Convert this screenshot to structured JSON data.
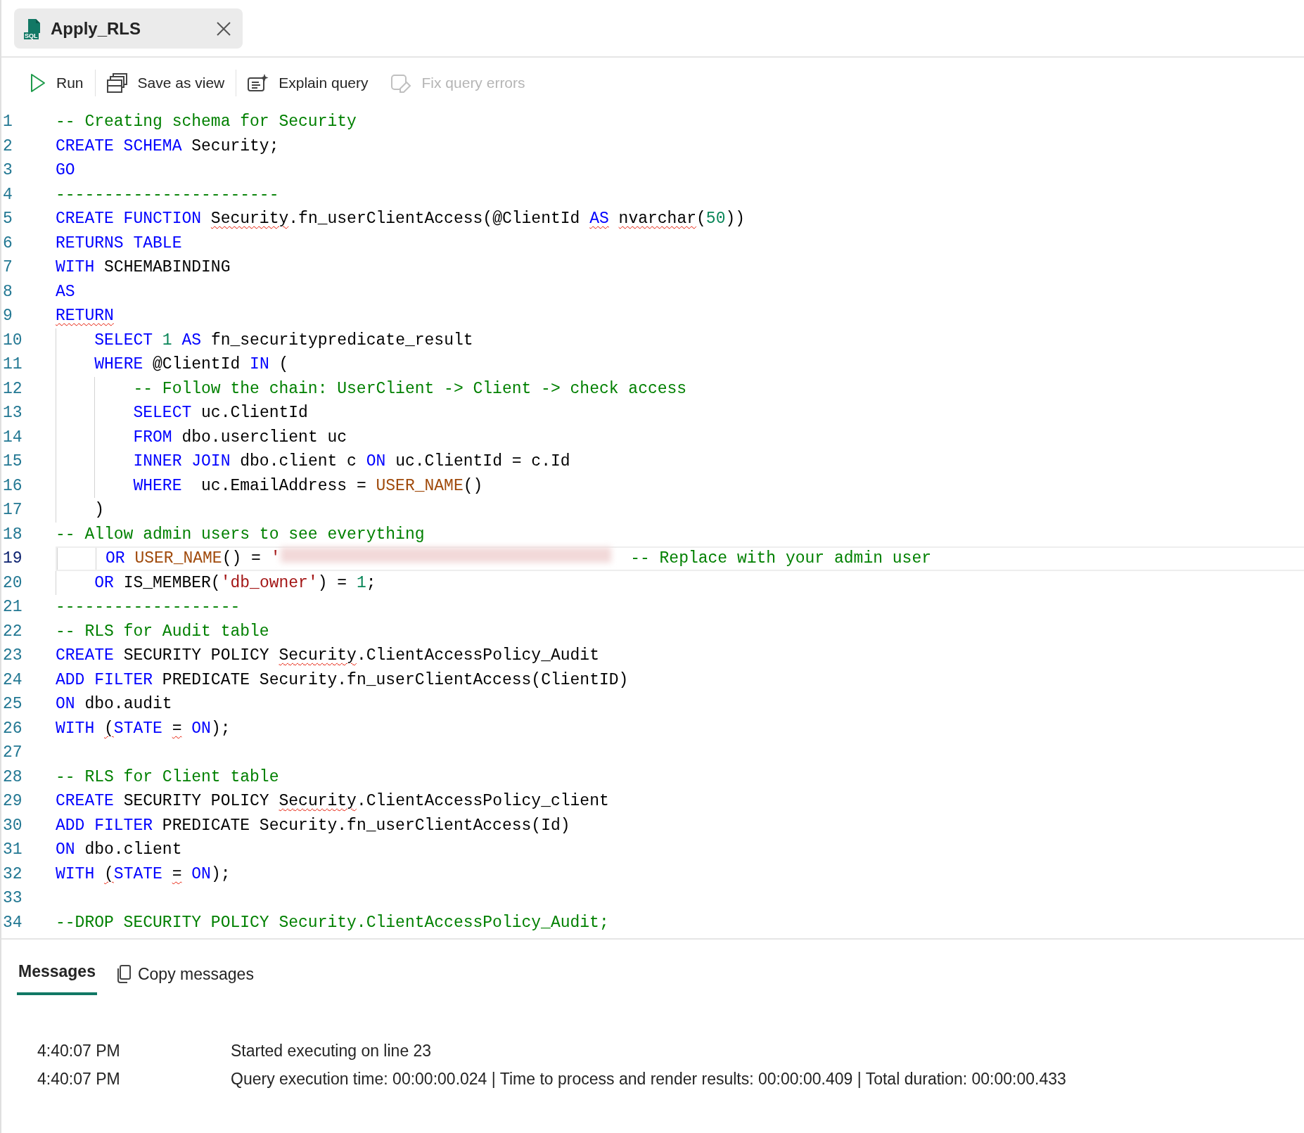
{
  "tab": {
    "title": "Apply_RLS",
    "icon_text": "SQL",
    "selected": true
  },
  "toolbar": [
    {
      "label": "Run",
      "disabled": false
    },
    {
      "label": "Save as view",
      "disabled": false
    },
    {
      "label": "Explain query",
      "disabled": false
    },
    {
      "label": "Fix query errors",
      "disabled": true
    }
  ],
  "editor": {
    "lines": [
      {
        "number": "1",
        "selected": false,
        "tokens": [
          {
            "t": "-- Creating schema for Security",
            "kind": "comment"
          }
        ]
      },
      {
        "number": "2",
        "selected": false,
        "tokens": [
          {
            "t": "CREATE SCHEMA",
            "kind": "keyword"
          },
          {
            "t": " Security;",
            "kind": "plain"
          }
        ]
      },
      {
        "number": "3",
        "selected": false,
        "tokens": [
          {
            "t": "GO",
            "kind": "keyword"
          }
        ]
      },
      {
        "number": "4",
        "selected": false,
        "tokens": [
          {
            "t": "-----------------------",
            "kind": "comment"
          }
        ]
      },
      {
        "number": "5",
        "selected": false,
        "tokens": [
          {
            "t": "CREATE FUNCTION ",
            "kind": "keyword"
          },
          {
            "t": "Security",
            "kind": "plain",
            "squiggle": true
          },
          {
            "t": ".fn_userClientAccess(@ClientId ",
            "kind": "plain"
          },
          {
            "t": "AS",
            "kind": "keyword",
            "squiggle": true
          },
          {
            "t": " nvarchar",
            "kind": "plain",
            "squiggle": true
          },
          {
            "t": "(",
            "kind": "plain"
          },
          {
            "t": "50",
            "kind": "number"
          },
          {
            "t": "))",
            "kind": "plain"
          }
        ]
      },
      {
        "number": "6",
        "selected": false,
        "tokens": [
          {
            "t": "RETURNS TABLE",
            "kind": "keyword"
          }
        ]
      },
      {
        "number": "7",
        "selected": false,
        "tokens": [
          {
            "t": "WITH",
            "kind": "keyword"
          },
          {
            "t": " SCHEMABINDING",
            "kind": "plain"
          }
        ]
      },
      {
        "number": "8",
        "selected": false,
        "tokens": [
          {
            "t": "AS",
            "kind": "keyword"
          }
        ]
      },
      {
        "number": "9",
        "selected": false,
        "tokens": [
          {
            "t": "RETURN",
            "kind": "keyword",
            "squiggle": true
          }
        ]
      },
      {
        "number": "10",
        "selected": false,
        "tokens": [
          {
            "t": "    SELECT ",
            "kind": "keyword"
          },
          {
            "t": "1",
            "kind": "number"
          },
          {
            "t": " AS",
            "kind": "keyword"
          },
          {
            "t": " fn_securitypredicate_result",
            "kind": "plain"
          }
        ]
      },
      {
        "number": "11",
        "selected": false,
        "tokens": [
          {
            "t": "    WHERE",
            "kind": "keyword"
          },
          {
            "t": " @ClientId ",
            "kind": "plain"
          },
          {
            "t": "IN",
            "kind": "keyword"
          },
          {
            "t": " (",
            "kind": "plain"
          }
        ]
      },
      {
        "number": "12",
        "selected": false,
        "tokens": [
          {
            "t": "        -- Follow the chain: UserClient -> Client -> check access",
            "kind": "comment"
          }
        ]
      },
      {
        "number": "13",
        "selected": false,
        "tokens": [
          {
            "t": "        SELECT",
            "kind": "keyword"
          },
          {
            "t": " uc.ClientId",
            "kind": "plain"
          }
        ]
      },
      {
        "number": "14",
        "selected": false,
        "tokens": [
          {
            "t": "        FROM",
            "kind": "keyword"
          },
          {
            "t": " dbo.userclient uc",
            "kind": "plain"
          }
        ]
      },
      {
        "number": "15",
        "selected": false,
        "tokens": [
          {
            "t": "        INNER JOIN",
            "kind": "keyword"
          },
          {
            "t": " dbo.client c ",
            "kind": "plain"
          },
          {
            "t": "ON",
            "kind": "keyword"
          },
          {
            "t": " uc.ClientId = c.Id",
            "kind": "plain"
          }
        ]
      },
      {
        "number": "16",
        "selected": false,
        "tokens": [
          {
            "t": "        WHERE",
            "kind": "keyword"
          },
          {
            "t": "  uc.EmailAddress = ",
            "kind": "plain"
          },
          {
            "t": "USER_NAME",
            "kind": "function"
          },
          {
            "t": "()",
            "kind": "plain"
          }
        ]
      },
      {
        "number": "17",
        "selected": false,
        "tokens": [
          {
            "t": "    )",
            "kind": "plain"
          }
        ]
      },
      {
        "number": "18",
        "selected": false,
        "tokens": [
          {
            "t": "-- Allow admin users to see everything",
            "kind": "comment"
          }
        ]
      },
      {
        "number": "19",
        "selected": true,
        "tokens": [
          {
            "t": "     OR ",
            "kind": "keyword"
          },
          {
            "t": "USER_NAME",
            "kind": "function"
          },
          {
            "t": "() = ",
            "kind": "plain"
          },
          {
            "t": "'",
            "kind": "string"
          },
          {
            "kind": "redacted"
          },
          {
            "t": "  -- Replace with your admin user",
            "kind": "comment"
          }
        ]
      },
      {
        "number": "20",
        "selected": false,
        "tokens": [
          {
            "t": "    OR",
            "kind": "keyword"
          },
          {
            "t": " IS_MEMBER(",
            "kind": "plain"
          },
          {
            "t": "'db_owner'",
            "kind": "string"
          },
          {
            "t": ") = ",
            "kind": "plain"
          },
          {
            "t": "1",
            "kind": "number"
          },
          {
            "t": ";",
            "kind": "plain"
          }
        ]
      },
      {
        "number": "21",
        "selected": false,
        "tokens": [
          {
            "t": "-------------------",
            "kind": "comment"
          }
        ]
      },
      {
        "number": "22",
        "selected": false,
        "tokens": [
          {
            "t": "-- RLS for Audit table",
            "kind": "comment"
          }
        ]
      },
      {
        "number": "23",
        "selected": false,
        "tokens": [
          {
            "t": "CREATE",
            "kind": "keyword"
          },
          {
            "t": " SECURITY POLICY ",
            "kind": "plain"
          },
          {
            "t": "Security",
            "kind": "plain",
            "squiggle": true
          },
          {
            "t": ".ClientAccessPolicy_Audit",
            "kind": "plain"
          }
        ]
      },
      {
        "number": "24",
        "selected": false,
        "tokens": [
          {
            "t": "ADD FILTER",
            "kind": "keyword"
          },
          {
            "t": " PREDICATE Security.fn_userClientAccess(ClientID)",
            "kind": "plain"
          }
        ]
      },
      {
        "number": "25",
        "selected": false,
        "tokens": [
          {
            "t": "ON",
            "kind": "keyword"
          },
          {
            "t": " dbo.audit",
            "kind": "plain"
          }
        ]
      },
      {
        "number": "26",
        "selected": false,
        "tokens": [
          {
            "t": "WITH ",
            "kind": "keyword"
          },
          {
            "t": "(",
            "kind": "plain",
            "squiggle": true
          },
          {
            "t": "STATE ",
            "kind": "keyword"
          },
          {
            "t": "=",
            "kind": "plain",
            "squiggle": true
          },
          {
            "t": " ON",
            "kind": "keyword"
          },
          {
            "t": ");",
            "kind": "plain"
          }
        ]
      },
      {
        "number": "27",
        "selected": false
      },
      {
        "number": "28",
        "selected": false,
        "tokens": [
          {
            "t": "-- RLS for Client table",
            "kind": "comment"
          }
        ]
      },
      {
        "number": "29",
        "selected": false,
        "tokens": [
          {
            "t": "CREATE",
            "kind": "keyword"
          },
          {
            "t": " SECURITY POLICY ",
            "kind": "plain"
          },
          {
            "t": "Security",
            "kind": "plain",
            "squiggle": true
          },
          {
            "t": ".ClientAccessPolicy_client",
            "kind": "plain"
          }
        ]
      },
      {
        "number": "30",
        "selected": false,
        "tokens": [
          {
            "t": "ADD FILTER",
            "kind": "keyword"
          },
          {
            "t": " PREDICATE Security.fn_userClientAccess(Id)",
            "kind": "plain"
          }
        ]
      },
      {
        "number": "31",
        "selected": false,
        "tokens": [
          {
            "t": "ON",
            "kind": "keyword"
          },
          {
            "t": " dbo.client",
            "kind": "plain"
          }
        ]
      },
      {
        "number": "32",
        "selected": false,
        "tokens": [
          {
            "t": "WITH ",
            "kind": "keyword"
          },
          {
            "t": "(",
            "kind": "plain",
            "squiggle": true
          },
          {
            "t": "STATE ",
            "kind": "keyword"
          },
          {
            "t": "=",
            "kind": "plain",
            "squiggle": true
          },
          {
            "t": " ON",
            "kind": "keyword"
          },
          {
            "t": ");",
            "kind": "plain"
          }
        ]
      },
      {
        "number": "33",
        "selected": false
      },
      {
        "number": "34",
        "selected": false,
        "tokens": [
          {
            "t": "--DROP SECURITY POLICY Security.ClientAccessPolicy_Audit;",
            "kind": "comment"
          }
        ]
      }
    ]
  },
  "results": {
    "tabs": [
      {
        "label": "Messages",
        "selected": true
      }
    ],
    "copy_button": "Copy messages",
    "messages": [
      {
        "time": "4:40:07 PM",
        "text": "Started executing on line 23"
      },
      {
        "time": "4:40:07 PM",
        "text": "Query execution time: 00:00:00.024 | Time to process and render results: 00:00:00.409 | Total duration: 00:00:00.433"
      }
    ]
  }
}
